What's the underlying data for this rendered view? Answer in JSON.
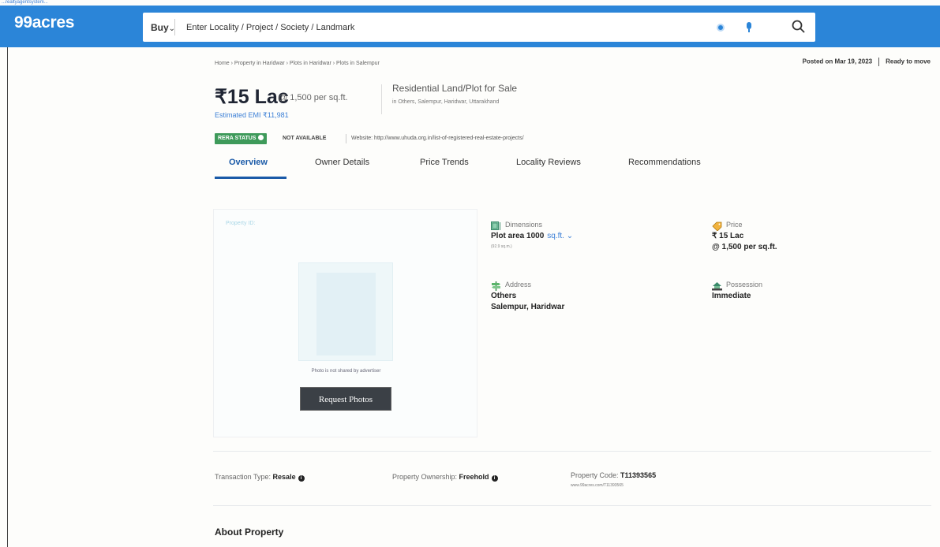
{
  "browser": {
    "url_fragment": "...realtyagentsystem..."
  },
  "header": {
    "logo": "99acres",
    "search": {
      "mode": "Buy",
      "placeholder": "Enter Locality / Project / Society / Landmark"
    },
    "accent_color": "#2b85d8"
  },
  "breadcrumb": "Home › Property in Haridwar › Plots in Haridwar › Plots in Salempur",
  "posted": {
    "date": "Posted on Mar 19, 2023",
    "status": "Ready to move"
  },
  "listing": {
    "price": "₹15 Lac",
    "price_per": "@ 1,500 per sq.ft.",
    "emi": "Estimated EMI ₹11,981",
    "type": "Residential Land/Plot for Sale",
    "location": "in Others, Salempur, Haridwar, Uttarakhand",
    "rera_label": "RERA STATUS",
    "rera_status": "NOT AVAILABLE",
    "rera_website": "Website: http://www.uhuda.org.in/list-of-registered-real-estate-projects/"
  },
  "tabs": [
    {
      "label": "Overview",
      "active": true
    },
    {
      "label": "Owner Details"
    },
    {
      "label": "Price Trends"
    },
    {
      "label": "Locality Reviews"
    },
    {
      "label": "Recommendations"
    }
  ],
  "photo": {
    "property_id": "Property ID:",
    "note": "Photo is not shared by advertiser",
    "button": "Request Photos"
  },
  "details": {
    "dimensions": {
      "label": "Dimensions",
      "value": "Plot area 1000",
      "unit": "sq.ft.",
      "sub": "(92.9 sq.m.)"
    },
    "price": {
      "label": "Price",
      "value": "₹ 15 Lac",
      "value2": "@ 1,500 per sq.ft."
    },
    "address": {
      "label": "Address",
      "value": "Others",
      "value2": "Salempur, Haridwar"
    },
    "possession": {
      "label": "Possession",
      "value": "Immediate"
    }
  },
  "facts": {
    "transaction_label": "Transaction Type: ",
    "transaction_value": "Resale",
    "ownership_label": "Property Ownership: ",
    "ownership_value": "Freehold",
    "code_label": "Property Code: ",
    "code_value": "T11393565",
    "code_sub": "www.99acres.com/T11393565"
  },
  "about": "About Property"
}
